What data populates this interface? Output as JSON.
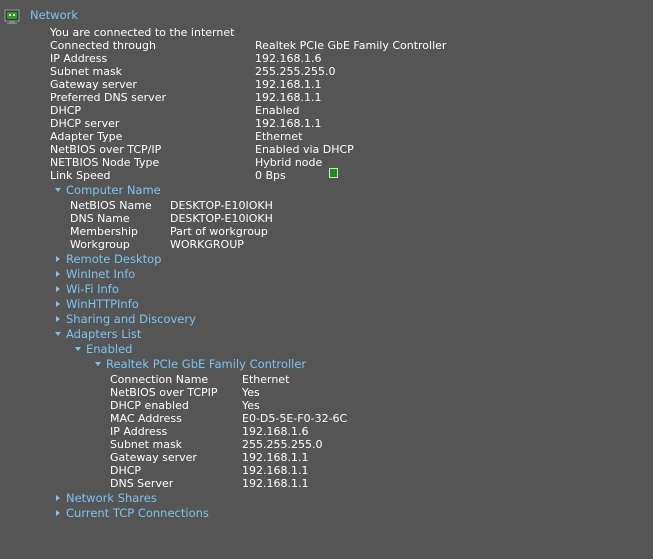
{
  "network": {
    "title": "Network",
    "rows": [
      {
        "label": "You are connected to the internet",
        "value": ""
      },
      {
        "label": "Connected through",
        "value": "Realtek PCIe GbE Family Controller"
      },
      {
        "label": "IP Address",
        "value": "192.168.1.6"
      },
      {
        "label": "Subnet mask",
        "value": "255.255.255.0"
      },
      {
        "label": "Gateway server",
        "value": "192.168.1.1"
      },
      {
        "label": "Preferred DNS server",
        "value": "192.168.1.1"
      },
      {
        "label": "DHCP",
        "value": "Enabled"
      },
      {
        "label": "DHCP server",
        "value": "192.168.1.1"
      },
      {
        "label": "Adapter Type",
        "value": "Ethernet"
      },
      {
        "label": "NetBIOS over TCP/IP",
        "value": "Enabled via DHCP"
      },
      {
        "label": "NETBIOS Node Type",
        "value": "Hybrid node"
      },
      {
        "label": "Link Speed",
        "value": "0 Bps"
      }
    ]
  },
  "computer_name": {
    "title": "Computer Name",
    "rows": [
      {
        "label": "NetBIOS Name",
        "value": "DESKTOP-E10IOKH"
      },
      {
        "label": "DNS Name",
        "value": "DESKTOP-E10IOKH"
      },
      {
        "label": "Membership",
        "value": "Part of workgroup"
      },
      {
        "label": "Workgroup",
        "value": "WORKGROUP"
      }
    ]
  },
  "collapsed_sections": [
    "Remote Desktop",
    "WinInet Info",
    "Wi-Fi Info",
    "WinHTTPInfo",
    "Sharing and Discovery"
  ],
  "adapters": {
    "title": "Adapters List",
    "enabled_label": "Enabled",
    "adapter_name": "Realtek PCIe GbE Family Controller",
    "rows": [
      {
        "label": "Connection Name",
        "value": "Ethernet"
      },
      {
        "label": "NetBIOS over TCPIP",
        "value": "Yes"
      },
      {
        "label": "DHCP enabled",
        "value": "Yes"
      },
      {
        "label": "MAC Address",
        "value": "E0-D5-5E-F0-32-6C"
      },
      {
        "label": "IP Address",
        "value": "192.168.1.6"
      },
      {
        "label": "Subnet mask",
        "value": "255.255.255.0"
      },
      {
        "label": "Gateway server",
        "value": "192.168.1.1"
      },
      {
        "label": "DHCP",
        "value": "192.168.1.1"
      },
      {
        "label": "DNS Server",
        "value": "192.168.1.1"
      }
    ]
  },
  "bottom_sections": [
    "Network Shares",
    "Current TCP Connections"
  ],
  "colors": {
    "background": "#555555",
    "section_text": "#7cc4f2",
    "text": "#ffffff",
    "link_indicator": "#1e8a1e"
  },
  "icons": {
    "network": "network-icon",
    "expanded": "chevron-down-icon",
    "collapsed": "chevron-right-icon"
  }
}
